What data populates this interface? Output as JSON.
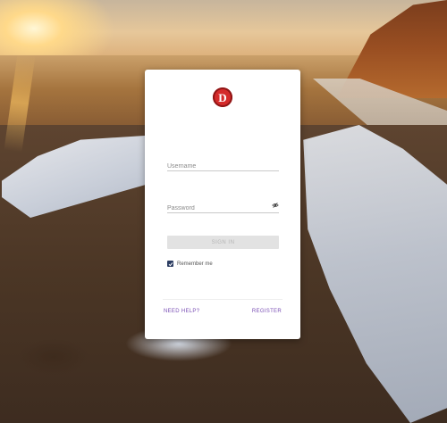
{
  "login": {
    "logo_letter": "D",
    "username_placeholder": "Username",
    "password_placeholder": "Password",
    "sign_in_label": "SIGN IN",
    "remember_me_label": "Remember me",
    "remember_me_checked": true,
    "need_help_label": "NEED HELP?",
    "register_label": "REGISTER"
  },
  "icons": {
    "logo": "brand-logo-icon",
    "password_toggle": "eye-icon",
    "checkbox": "checkmark-icon"
  },
  "colors": {
    "logo_red": "#d42a2a",
    "link_purple": "#7a4fb5",
    "checkbox_navy": "#2d3e63",
    "button_disabled": "#e2e2e2"
  }
}
